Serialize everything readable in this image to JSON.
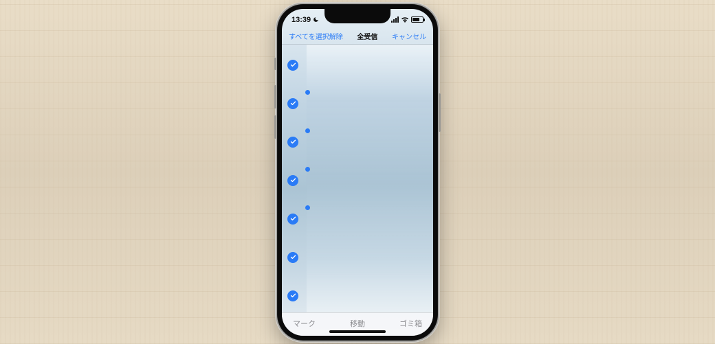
{
  "status": {
    "time": "13:39"
  },
  "nav": {
    "left": "すべてを選択解除",
    "title": "全受信",
    "right": "キャンセル"
  },
  "list": {
    "rows": [
      {
        "checked": true,
        "unread": false
      },
      {
        "checked": true,
        "unread": true
      },
      {
        "checked": true,
        "unread": true
      },
      {
        "checked": true,
        "unread": true
      },
      {
        "checked": true,
        "unread": true
      },
      {
        "checked": true,
        "unread": false
      },
      {
        "checked": true,
        "unread": false
      }
    ]
  },
  "toolbar": {
    "mark": "マーク",
    "move": "移動",
    "trash": "ゴミ箱"
  }
}
